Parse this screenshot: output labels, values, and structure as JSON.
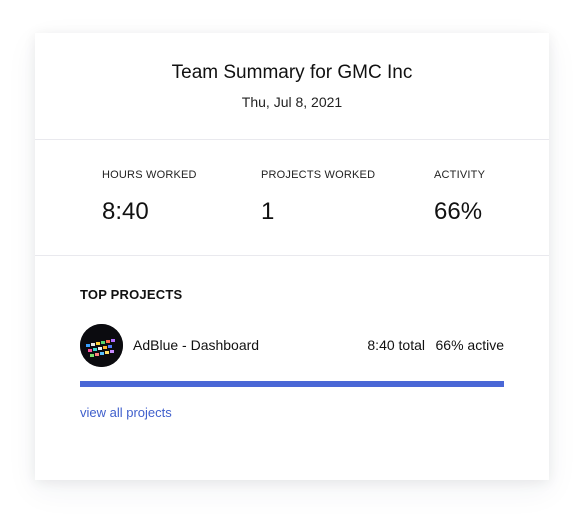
{
  "header": {
    "title": "Team Summary for GMC Inc",
    "date": "Thu, Jul 8, 2021"
  },
  "stats": [
    {
      "label": "HOURS WORKED",
      "value": "8:40"
    },
    {
      "label": "PROJECTS WORKED",
      "value": "1"
    },
    {
      "label": "ACTIVITY",
      "value": "66%"
    }
  ],
  "top_projects": {
    "title": "TOP PROJECTS",
    "items": [
      {
        "name": "AdBlue - Dashboard",
        "total": "8:40 total",
        "active": "66% active",
        "share_of_time": 1.0,
        "avatar_icon": "project-thumbnail-icon"
      }
    ],
    "view_all_label": "view all projects"
  },
  "colors": {
    "accent": "#4a67d6",
    "link": "#3f5fcc"
  }
}
